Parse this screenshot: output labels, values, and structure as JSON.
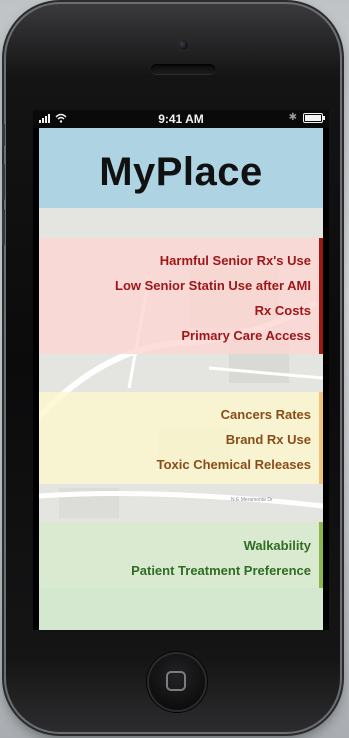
{
  "status_bar": {
    "signal_icon": "signal-bars-icon",
    "wifi_icon": "wifi-icon",
    "time": "9:41 AM",
    "bluetooth_icon": "bluetooth-icon",
    "battery_icon": "battery-icon"
  },
  "app": {
    "title": "MyPlace",
    "header_color": "#aed3e3"
  },
  "groups": [
    {
      "color": "#9c1a12",
      "items": [
        "Harmful Senior Rx's Use",
        "Low Senior Statin Use after AMI",
        "Rx Costs",
        "Primary Care Access"
      ]
    },
    {
      "color": "#f0c27a",
      "items": [
        "Cancers Rates",
        "Brand Rx Use",
        "Toxic Chemical Releases"
      ]
    },
    {
      "color": "#8bb84a",
      "items": [
        "Walkability",
        "Patient Treatment Preference"
      ]
    }
  ],
  "map": {
    "street_label": "N E Meramonte Dr"
  },
  "device": {
    "home_icon": "home-button-icon"
  }
}
